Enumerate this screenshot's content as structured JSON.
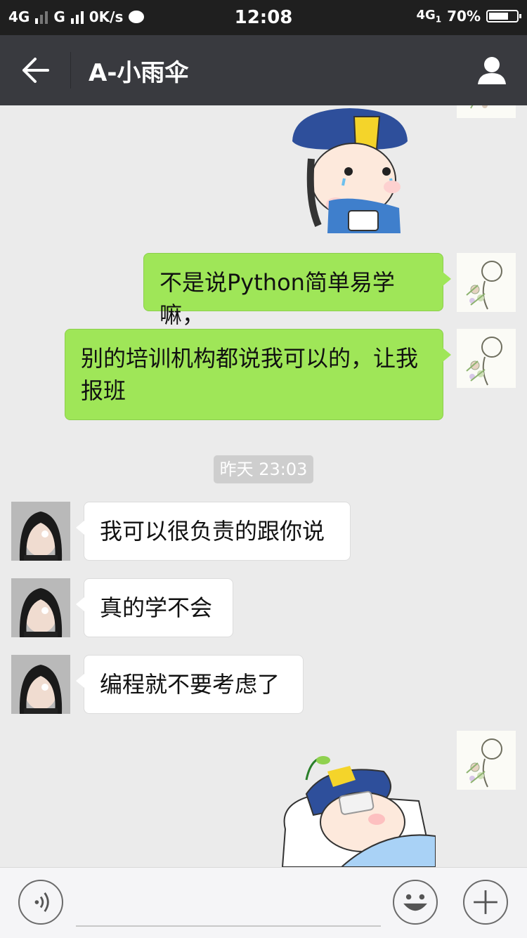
{
  "status_bar": {
    "left_label_1": "4G",
    "left_label_2": "G",
    "speed": "0K/s",
    "time": "12:08",
    "network_right": "4G",
    "sim_index": "1",
    "battery": "70%",
    "battery_level": 0.7
  },
  "header": {
    "title": "A-小雨伞",
    "icons": [
      "back-arrow-icon",
      "person-icon"
    ]
  },
  "messages": [
    {
      "from": "me",
      "text": "不是说Python简单易学嘛，"
    },
    {
      "from": "me",
      "text": "别的培训机构都说我可以的，让我报班"
    },
    {
      "from": "them",
      "text": "我可以很负责的跟你说"
    },
    {
      "from": "them",
      "text": "真的学不会"
    },
    {
      "from": "them",
      "text": "编程就不要考虑了"
    }
  ],
  "timestamp": "昨天 23:03",
  "colors": {
    "header_bg": "#393a3f",
    "chat_bg": "#ebebeb",
    "my_bubble": "#9fe658",
    "their_bubble": "#ffffff"
  },
  "bottom_bar": {
    "icons": [
      "voice-icon",
      "emoji-icon",
      "plus-icon"
    ]
  }
}
